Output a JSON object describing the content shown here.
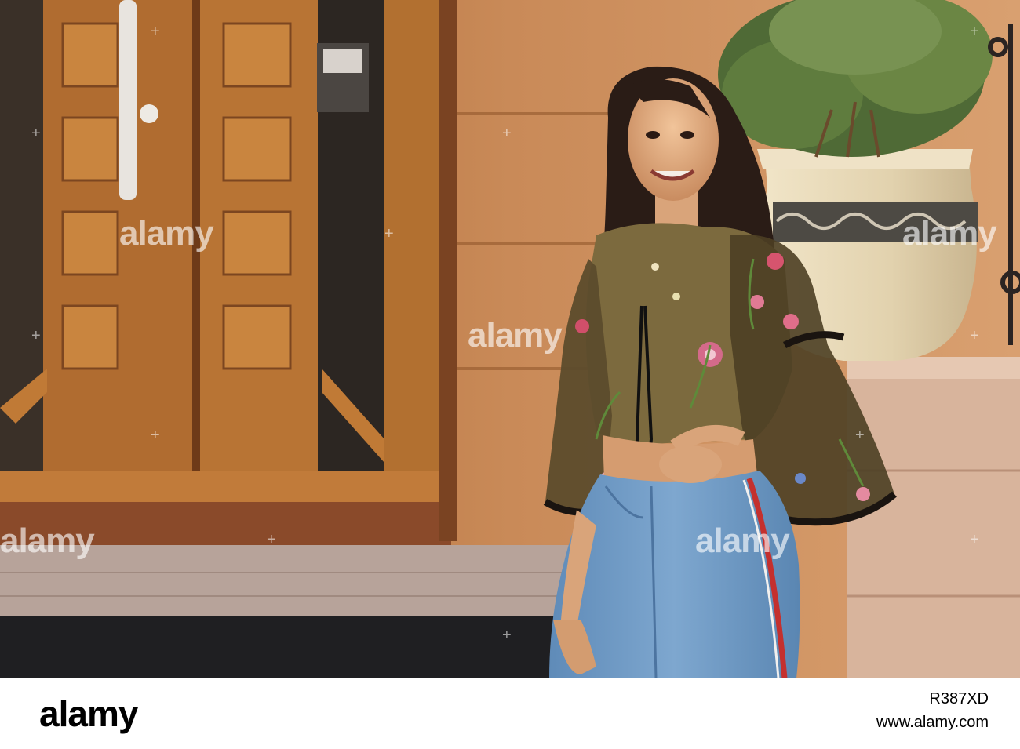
{
  "watermark": {
    "text": "alamy"
  },
  "footer": {
    "logo": "alamy",
    "image_id": "R387XD",
    "site": "www.alamy.com"
  },
  "colors": {
    "door_wood": "#b8722f",
    "wall_sand": "#c98a58",
    "pot_cream": "#e6d7b6",
    "blouse_olive": "#7c6a3e",
    "jeans_blue": "#6f9ac4"
  }
}
